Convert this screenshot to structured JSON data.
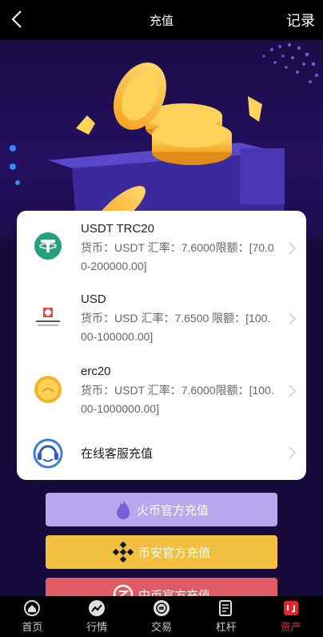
{
  "header": {
    "title": "充值",
    "record_label": "记录"
  },
  "channels": [
    {
      "name": "USDT TRC20",
      "desc": "货币：USDT 汇率：7.6000限额：[70.00-200000.00]",
      "icon": "tether-logo-icon"
    },
    {
      "name": "USD",
      "desc": "货币：USD 汇率：7.6500 限额：[100.00-100000.00]",
      "icon": "bank-logo-icon"
    },
    {
      "name": "erc20",
      "desc": "货币：USDT 汇率：7.6000限额：[100.00-1000000.00]",
      "icon": "gold-coin-icon"
    },
    {
      "name": "在线客服充值",
      "icon": "headset-icon"
    }
  ],
  "buttons": [
    {
      "label": "火币官方充值",
      "color": "#b8a9ee",
      "icon": "huobi-flame-icon"
    },
    {
      "label": "币安官方充值",
      "color": "#f3bf3f",
      "icon": "binance-icon"
    },
    {
      "label": "中币官方充值",
      "color": "#de5c62",
      "icon": "zb-icon"
    }
  ],
  "tabs": [
    {
      "label": "首页",
      "icon": "home-icon",
      "active": false
    },
    {
      "label": "行情",
      "icon": "chart-trend-icon",
      "active": false
    },
    {
      "label": "交易",
      "icon": "exchange-icon",
      "active": false
    },
    {
      "label": "杠杆",
      "icon": "document-icon",
      "active": false
    },
    {
      "label": "资产",
      "icon": "wallet-icon",
      "active": true
    }
  ],
  "colors": {
    "background": "#160a3a",
    "active_tab": "#e8232f"
  }
}
